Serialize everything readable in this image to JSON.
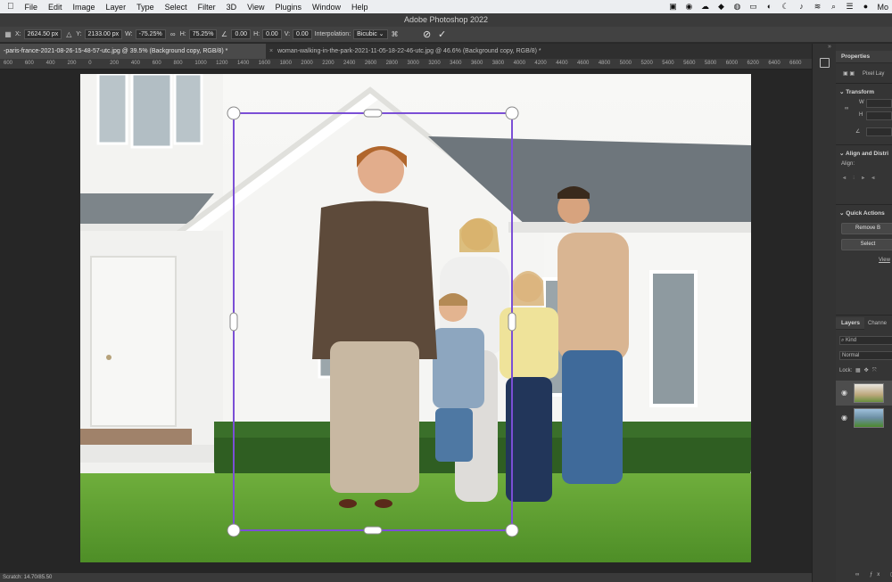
{
  "menubar": {
    "apple": "",
    "items": [
      "File",
      "Edit",
      "Image",
      "Layer",
      "Type",
      "Select",
      "Filter",
      "3D",
      "View",
      "Plugins",
      "Window",
      "Help"
    ],
    "right_label": "Mo"
  },
  "window": {
    "title": "Adobe Photoshop 2022"
  },
  "options": {
    "x_label": "X:",
    "x_value": "2624.50 px",
    "y_label": "Y:",
    "y_value": "2133.00 px",
    "w_label": "W:",
    "w_value": "-75.25%",
    "h_label": "H:",
    "h_value": "75.25%",
    "angle_value": "0.00",
    "hskew_label": "H:",
    "hskew_value": "0.00",
    "vskew_label": "V:",
    "vskew_value": "0.00",
    "interpolation_label": "Interpolation:",
    "interpolation_value": "Bicubic"
  },
  "tabs": [
    {
      "label": "-paris-france-2021-08-26-15-48-57-utc.jpg @ 39.5% (Background copy, RGB/8) *"
    },
    {
      "label": "woman-walking-in-the-park-2021-11-05-18-22-46-utc.jpg @ 46.6% (Background copy, RGB/8) *"
    }
  ],
  "ruler": {
    "ticks": [
      "600",
      "600",
      "400",
      "200",
      "0",
      "200",
      "400",
      "600",
      "800",
      "1000",
      "1200",
      "1400",
      "1600",
      "1800",
      "2000",
      "2200",
      "2400",
      "2600",
      "2800",
      "3000",
      "3200",
      "3400",
      "3600",
      "3800",
      "4000",
      "4200",
      "4400",
      "4600",
      "4800",
      "5000",
      "5200",
      "5400",
      "5600",
      "5800",
      "6000",
      "6200",
      "6400",
      "6600"
    ]
  },
  "status": {
    "text": "Scratch: 14.70/85.50"
  },
  "panel": {
    "properties_tab": "Properties",
    "pixel_layer": "Pixel Lay",
    "transform": "Transform",
    "w_label": "W",
    "h_label": "H",
    "align_title": "Align and Distri",
    "align_label": "Align:",
    "quick_actions": "Quick Actions",
    "remove_bg": "Remove B",
    "select_subject": "Select",
    "view_more": "View",
    "layers_tab": "Layers",
    "channels_tab": "Channe",
    "kind": "Kind",
    "blend": "Normal",
    "lock": "Lock:"
  },
  "colors": {
    "accent": "#7b4fd6",
    "menubar_bg": "#eceef1",
    "ui_bg": "#282828"
  }
}
